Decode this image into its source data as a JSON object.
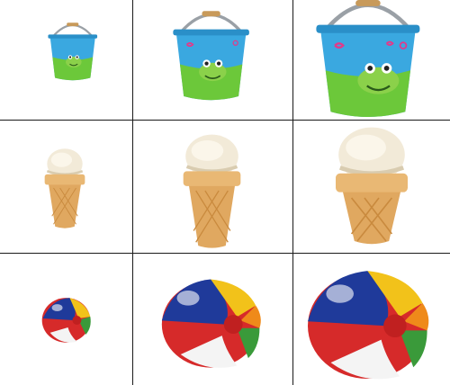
{
  "grid": {
    "rows": [
      {
        "object": "bucket",
        "sizes": [
          "small",
          "medium",
          "large"
        ],
        "colors": {
          "body_top": "#3aa8e0",
          "body_bottom": "#6cc83a",
          "rim": "#2a8fc8",
          "handle": "#9aa0a6",
          "grip": "#c89a5a",
          "frog": "#8bd14a",
          "swirl": "#e23a8a"
        }
      },
      {
        "object": "ice-cream-cone",
        "sizes": [
          "small",
          "medium",
          "large"
        ],
        "colors": {
          "scoop": "#f2ead8",
          "scoop_shade": "#d9ccb0",
          "cone": "#e0a860",
          "cone_shade": "#c98a3e",
          "cone_rim": "#e9b874"
        }
      },
      {
        "object": "beach-ball",
        "sizes": [
          "small",
          "medium",
          "large"
        ],
        "colors": {
          "blue": "#1f3a9a",
          "red": "#d62a2a",
          "white": "#f4f4f4",
          "yellow": "#f2c21a",
          "green": "#3a9a3a",
          "orange": "#ef8a1a"
        }
      }
    ]
  }
}
